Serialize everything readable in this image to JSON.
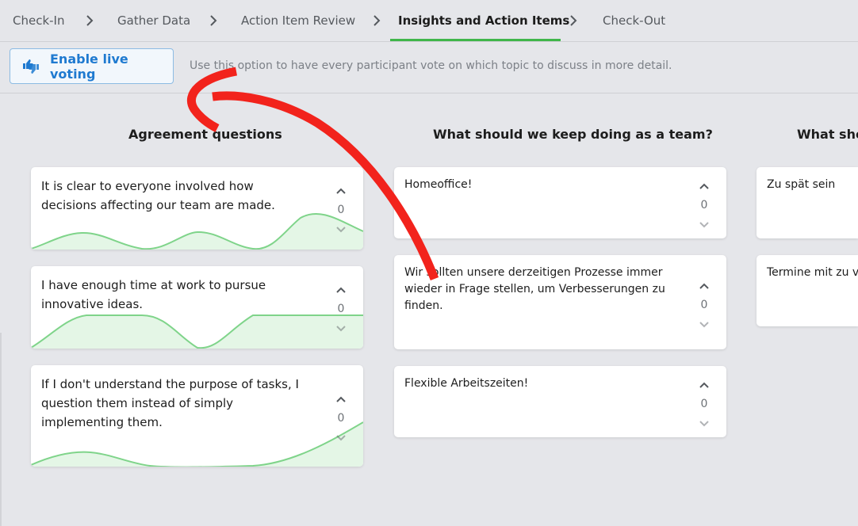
{
  "stepper": {
    "steps": [
      {
        "label": "Check-In"
      },
      {
        "label": "Gather Data"
      },
      {
        "label": "Action Item Review"
      },
      {
        "label": "Insights and Action Items"
      },
      {
        "label": "Check-Out"
      }
    ],
    "active_index": 3
  },
  "voting": {
    "button_label": "Enable live voting",
    "hint": "Use this option to have every participant vote on which topic to discuss in more detail."
  },
  "columns": [
    {
      "title": "Agreement questions",
      "cards": [
        {
          "text": "It is clear to everyone involved how decisions affecting our team are made.",
          "votes": "0"
        },
        {
          "text": "I have enough time at work to pursue innovative ideas.",
          "votes": "0"
        },
        {
          "text": "If I don't understand the purpose of tasks, I question them instead of simply implementing them.",
          "votes": "0"
        }
      ]
    },
    {
      "title": "What should we keep doing as a team?",
      "cards": [
        {
          "text": "Homeoffice!",
          "votes": "0"
        },
        {
          "text": "Wir sollten unsere derzeitigen Prozesse immer wieder in Frage stellen, um Verbesserungen zu finden.",
          "votes": "0"
        },
        {
          "text": "Flexible Arbeitszeiten!",
          "votes": "0"
        }
      ]
    },
    {
      "title": "What sho",
      "cards": [
        {
          "text": "Zu spät sein"
        },
        {
          "text": "Termine mit zu vi"
        }
      ]
    }
  ],
  "colors": {
    "accent_green": "#3fb64a",
    "button_blue": "#1f7ad0",
    "sparkline_green": "#7fd48a",
    "annotation_red": "#f2231c",
    "background": "#e5e6ea"
  },
  "icons": {
    "vote_button": "thumbs-up-down-icon",
    "step_separator": "chevron-right-icon",
    "vote_up": "chevron-up-icon",
    "vote_down": "chevron-down-icon"
  }
}
